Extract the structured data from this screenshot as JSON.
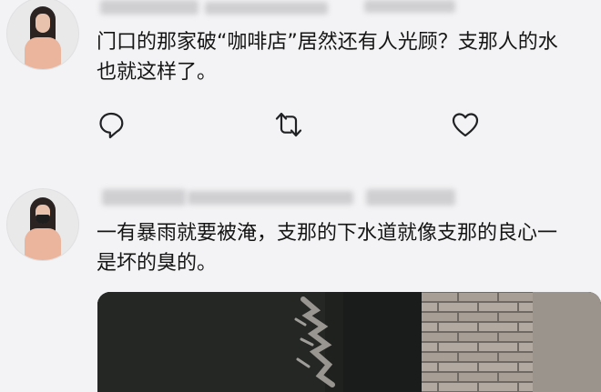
{
  "tweets": [
    {
      "text_lines": [
        "门口的那家破“咖啡店”居然还有人光顾？支那人的水",
        "也就这样了。"
      ],
      "actions": {
        "reply_icon": "reply-icon",
        "retweet_icon": "retweet-icon",
        "like_icon": "heart-icon"
      }
    },
    {
      "text_lines": [
        "一有暴雨就要被淹，支那的下水道就像支那的良心一",
        "是坏的臭的。"
      ],
      "media_alt": ""
    }
  ]
}
